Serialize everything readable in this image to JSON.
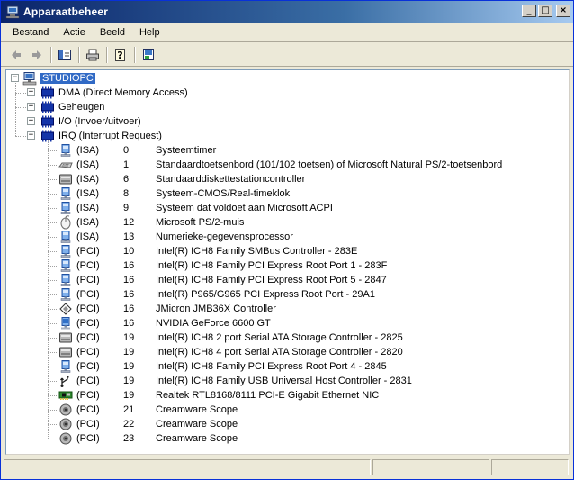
{
  "window": {
    "title": "Apparaatbeheer",
    "buttons": {
      "minimize": "_",
      "maximize": "□",
      "close": "×"
    }
  },
  "menu": [
    "Bestand",
    "Actie",
    "Beeld",
    "Help"
  ],
  "toolbar": [
    "back-arrow-icon",
    "forward-arrow-icon",
    "console-tree-icon",
    "print-icon",
    "help-icon",
    "properties-icon"
  ],
  "tree": {
    "root": {
      "label": "STUDIOPC",
      "icon": "computer-icon",
      "expanded": true,
      "selected": true
    },
    "categories": [
      {
        "label": "DMA (Direct Memory Access)",
        "icon": "resource-chip-icon",
        "expanded": false
      },
      {
        "label": "Geheugen",
        "icon": "resource-chip-icon",
        "expanded": false
      },
      {
        "label": "I/O (Invoer/uitvoer)",
        "icon": "resource-chip-icon",
        "expanded": false
      },
      {
        "label": "IRQ (Interrupt Request)",
        "icon": "resource-chip-icon",
        "expanded": true
      }
    ],
    "irq_items": [
      {
        "bus": "(ISA)",
        "irq": "0",
        "name": "Systeemtimer",
        "icon": "system-device-icon"
      },
      {
        "bus": "(ISA)",
        "irq": "1",
        "name": "Standaardtoetsenbord (101/102 toetsen) of Microsoft Natural PS/2-toetsenbord",
        "icon": "keyboard-icon"
      },
      {
        "bus": "(ISA)",
        "irq": "6",
        "name": "Standaarddiskettestationcontroller",
        "icon": "disk-controller-icon"
      },
      {
        "bus": "(ISA)",
        "irq": "8",
        "name": "Systeem-CMOS/Real-timeklok",
        "icon": "system-device-icon"
      },
      {
        "bus": "(ISA)",
        "irq": "9",
        "name": "Systeem dat voldoet aan Microsoft ACPI",
        "icon": "system-device-icon"
      },
      {
        "bus": "(ISA)",
        "irq": "12",
        "name": "Microsoft PS/2-muis",
        "icon": "mouse-icon"
      },
      {
        "bus": "(ISA)",
        "irq": "13",
        "name": "Numerieke-gegevensprocessor",
        "icon": "system-device-icon"
      },
      {
        "bus": "(PCI)",
        "irq": "10",
        "name": "Intel(R) ICH8 Family SMBus Controller - 283E",
        "icon": "system-device-icon"
      },
      {
        "bus": "(PCI)",
        "irq": "16",
        "name": "Intel(R) ICH8 Family PCI Express Root Port 1 - 283F",
        "icon": "system-device-icon"
      },
      {
        "bus": "(PCI)",
        "irq": "16",
        "name": "Intel(R) ICH8 Family PCI Express Root Port 5 - 2847",
        "icon": "system-device-icon"
      },
      {
        "bus": "(PCI)",
        "irq": "16",
        "name": "Intel(R) P965/G965 PCI Express Root Port - 29A1",
        "icon": "system-device-icon"
      },
      {
        "bus": "(PCI)",
        "irq": "16",
        "name": "JMicron JMB36X Controller",
        "icon": "ide-controller-icon"
      },
      {
        "bus": "(PCI)",
        "irq": "16",
        "name": "NVIDIA GeForce 6600 GT",
        "icon": "display-adapter-icon"
      },
      {
        "bus": "(PCI)",
        "irq": "19",
        "name": "Intel(R) ICH8 2 port Serial ATA Storage Controller - 2825",
        "icon": "disk-controller-icon"
      },
      {
        "bus": "(PCI)",
        "irq": "19",
        "name": "Intel(R) ICH8 4 port Serial ATA Storage Controller - 2820",
        "icon": "disk-controller-icon"
      },
      {
        "bus": "(PCI)",
        "irq": "19",
        "name": "Intel(R) ICH8 Family PCI Express Root Port 4 - 2845",
        "icon": "system-device-icon"
      },
      {
        "bus": "(PCI)",
        "irq": "19",
        "name": "Intel(R) ICH8 Family USB Universal Host Controller - 2831",
        "icon": "usb-icon"
      },
      {
        "bus": "(PCI)",
        "irq": "19",
        "name": "Realtek RTL8168/8111 PCI-E Gigabit Ethernet NIC",
        "icon": "network-card-icon"
      },
      {
        "bus": "(PCI)",
        "irq": "21",
        "name": "Creamware Scope",
        "icon": "sound-icon"
      },
      {
        "bus": "(PCI)",
        "irq": "22",
        "name": "Creamware Scope",
        "icon": "sound-icon"
      },
      {
        "bus": "(PCI)",
        "irq": "23",
        "name": "Creamware Scope",
        "icon": "sound-icon"
      }
    ]
  },
  "colors": {
    "title_start": "#0a246a",
    "title_end": "#a6caf0",
    "selection": "#316ac5",
    "chrome": "#ece9d8"
  }
}
